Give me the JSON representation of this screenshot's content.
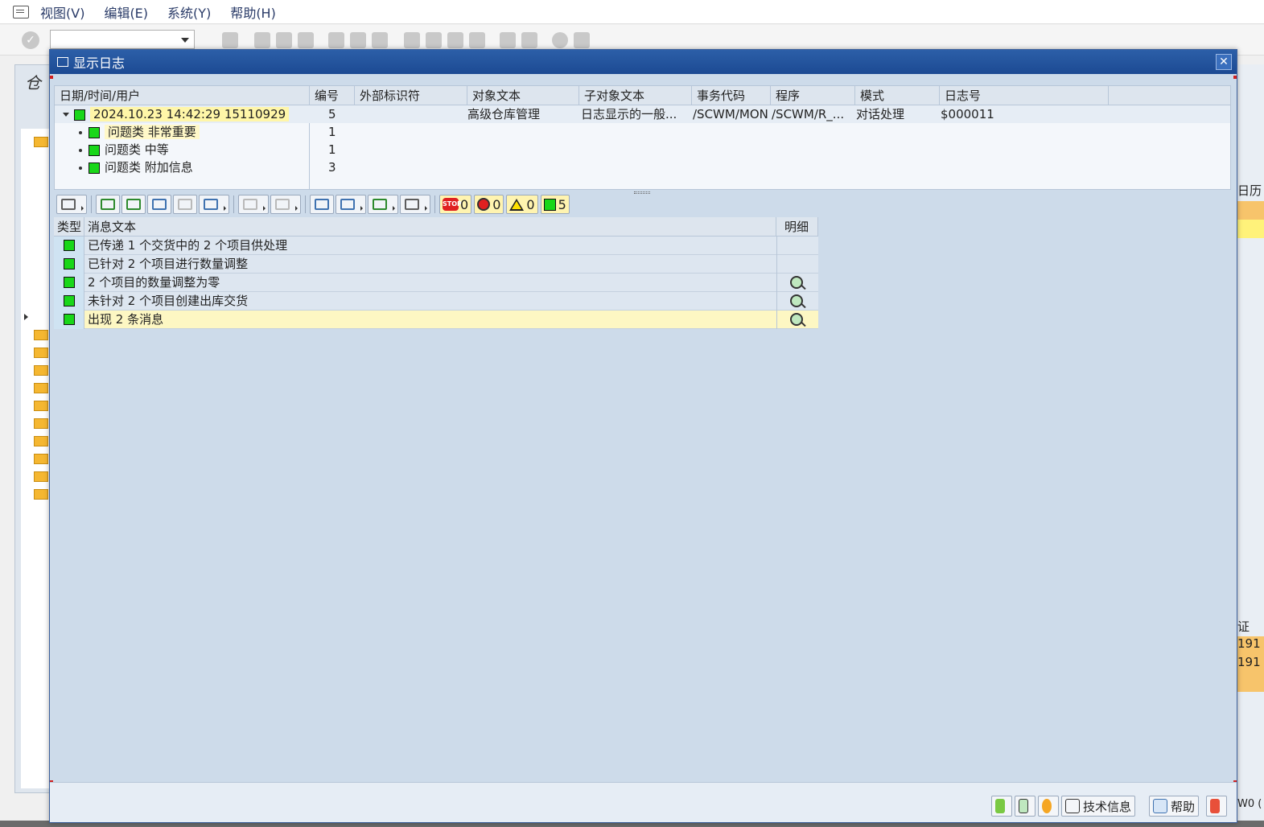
{
  "menubar": {
    "items": [
      "视图(V)",
      "编辑(E)",
      "系统(Y)",
      "帮助(H)"
    ]
  },
  "background": {
    "left_title": "仓",
    "right_cells": [
      "日历",
      "证",
      "191",
      "191",
      "W0 ("
    ]
  },
  "dialog": {
    "title": "显示日志",
    "close_glyph": "✕"
  },
  "log_table": {
    "headers": [
      "日期/时间/用户",
      "编号",
      "外部标识符",
      "对象文本",
      "子对象文本",
      "事务代码",
      "程序",
      "模式",
      "日志号"
    ],
    "main_row": {
      "date": "2024.10.23",
      "time": "14:42:29",
      "user": "15110929",
      "number": "5",
      "external_id": "",
      "object_text": "高级仓库管理",
      "subobject_text": "日志显示的一般...",
      "tcode": "/SCWM/MON",
      "program": "/SCWM/R_...",
      "mode": "对话处理",
      "log_no": "$000011"
    },
    "children": [
      {
        "label": "问题类 非常重要",
        "number": "1"
      },
      {
        "label": "问题类 中等",
        "number": "1"
      },
      {
        "label": "问题类 附加信息",
        "number": "3"
      }
    ]
  },
  "counters": {
    "stop": "0",
    "error": "0",
    "warning": "0",
    "success": "5",
    "stop_label": "STOP"
  },
  "messages": {
    "headers": {
      "type": "类型",
      "text": "消息文本",
      "detail": "明细"
    },
    "rows": [
      {
        "text": "已传递 1 个交货中的 2 个项目供处理",
        "has_detail": false
      },
      {
        "text": "已针对 2 个项目进行数量调整",
        "has_detail": false
      },
      {
        "text": "2 个项目的数量调整为零",
        "has_detail": true
      },
      {
        "text": "未针对 2 个项目创建出库交货",
        "has_detail": true
      },
      {
        "text": "出现 2 条消息",
        "has_detail": true
      }
    ]
  },
  "footer": {
    "tech_info_label": "技术信息",
    "help_label": "帮助"
  },
  "colors": {
    "status_green": "#19d719",
    "title_blue": "#1c4a93",
    "selected_row": "#fdf7c3"
  }
}
